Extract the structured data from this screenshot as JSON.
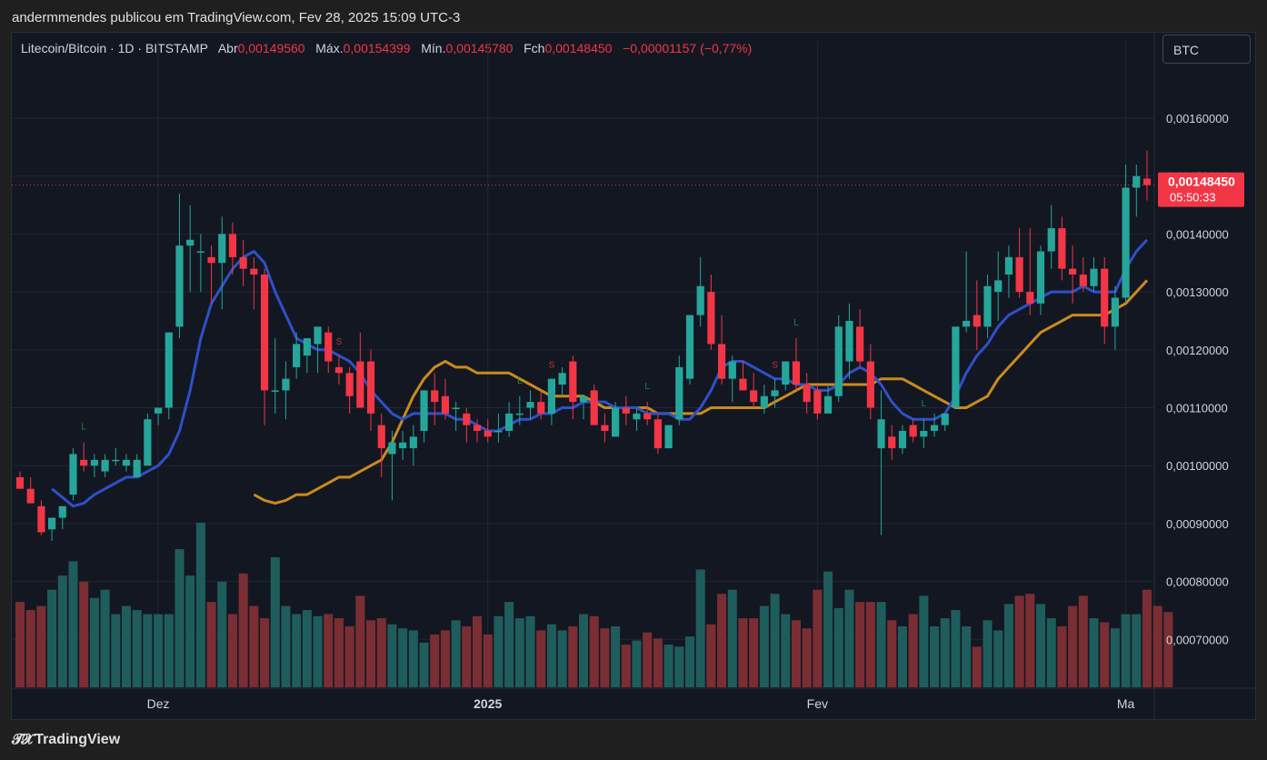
{
  "publisher_line": "andermmendes publicou em TradingView.com, Fev 28, 2025 15:09 UTC-3",
  "symbol": {
    "title": "Litecoin/Bitcoin · 1D · BITSTAMP",
    "open_label": "Abr",
    "open": "0,00149560",
    "high_label": "Máx.",
    "high": "0,00154399",
    "low_label": "Mín.",
    "low": "0,00145780",
    "close_label": "Fch",
    "close": "0,00148450",
    "change": "−0,00001157 (−0,77%)"
  },
  "currency_button": "BTC",
  "price_badge": {
    "price": "0,00148450",
    "countdown": "05:50:33"
  },
  "branding": {
    "icon": "tradingview-logo-icon",
    "name": "TradingView"
  },
  "colors": {
    "up": "#26a69a",
    "down": "#f23645",
    "fast_ma": "#2f50c8",
    "slow_ma": "#c98a1f",
    "vol_up": "#1f5c5c",
    "vol_down": "#7a2e33"
  },
  "chart_data": {
    "type": "candlestick",
    "title": "",
    "ylim": [
      0.00086,
      0.00169
    ],
    "y_ticks": [
      0.0016,
      0.0015,
      0.0014,
      0.0013,
      0.0012,
      0.0011,
      0.001,
      0.0009,
      0.0008,
      0.0007
    ],
    "y_tick_labels": [
      "0,00160000",
      "0,00150000",
      "0,00140000",
      "0,00130000",
      "0,00120000",
      "0,00110000",
      "0,00100000",
      "0,00090000",
      "0,00080000",
      "0,00070000"
    ],
    "x_labels": [
      {
        "text": "Dez",
        "index": 13
      },
      {
        "text": "2025",
        "index": 44
      },
      {
        "text": "Fev",
        "index": 75
      },
      {
        "text": "Ma",
        "index": 104
      }
    ],
    "candles": [
      [
        0.00098,
        0.00099,
        0.000965,
        0.00096
      ],
      [
        0.00096,
        0.00098,
        0.000935,
        0.000935
      ],
      [
        0.00093,
        0.00094,
        0.00088,
        0.000885
      ],
      [
        0.00089,
        0.0009,
        0.00087,
        0.00091
      ],
      [
        0.00091,
        0.00093,
        0.00089,
        0.00093
      ],
      [
        0.00095,
        0.00103,
        0.00094,
        0.00102
      ],
      [
        0.00101,
        0.00104,
        0.00099,
        0.001
      ],
      [
        0.001,
        0.00102,
        0.00098,
        0.00101
      ],
      [
        0.00099,
        0.00102,
        0.00098,
        0.00101
      ],
      [
        0.00101,
        0.00103,
        0.001,
        0.00101
      ],
      [
        0.001,
        0.00102,
        0.00099,
        0.00101
      ],
      [
        0.00098,
        0.00102,
        0.00098,
        0.00101
      ],
      [
        0.001,
        0.00109,
        0.001,
        0.00108
      ],
      [
        0.00109,
        0.0011,
        0.00107,
        0.0011
      ],
      [
        0.0011,
        0.00123,
        0.00108,
        0.00123
      ],
      [
        0.00124,
        0.00147,
        0.00122,
        0.00138
      ],
      [
        0.00138,
        0.00145,
        0.0013,
        0.00139
      ],
      [
        0.00137,
        0.0014,
        0.0013,
        0.00137
      ],
      [
        0.00136,
        0.00138,
        0.00128,
        0.00135
      ],
      [
        0.00135,
        0.00143,
        0.00127,
        0.0014
      ],
      [
        0.0014,
        0.00142,
        0.00133,
        0.00136
      ],
      [
        0.00136,
        0.00139,
        0.00131,
        0.00134
      ],
      [
        0.00134,
        0.00136,
        0.00127,
        0.00133
      ],
      [
        0.00133,
        0.00134,
        0.00107,
        0.00113
      ],
      [
        0.00113,
        0.00122,
        0.00109,
        0.00113
      ],
      [
        0.00113,
        0.00118,
        0.00108,
        0.00115
      ],
      [
        0.00117,
        0.00123,
        0.00115,
        0.00121
      ],
      [
        0.00119,
        0.00122,
        0.00116,
        0.00122
      ],
      [
        0.00121,
        0.00123,
        0.00116,
        0.00124
      ],
      [
        0.00123,
        0.00124,
        0.00116,
        0.00118
      ],
      [
        0.00117,
        0.00119,
        0.00114,
        0.00116
      ],
      [
        0.00116,
        0.00117,
        0.00109,
        0.00112
      ],
      [
        0.00118,
        0.00123,
        0.00112,
        0.0011
      ],
      [
        0.00118,
        0.0012,
        0.00106,
        0.00109
      ],
      [
        0.00107,
        0.00109,
        0.00098,
        0.00103
      ],
      [
        0.00102,
        0.00106,
        0.00094,
        0.00104
      ],
      [
        0.00103,
        0.00106,
        0.00101,
        0.00104
      ],
      [
        0.00103,
        0.00107,
        0.001,
        0.00105
      ],
      [
        0.00106,
        0.00113,
        0.00104,
        0.00113
      ],
      [
        0.00113,
        0.00116,
        0.00107,
        0.00111
      ],
      [
        0.00112,
        0.00115,
        0.00108,
        0.00109
      ],
      [
        0.0011,
        0.00111,
        0.00106,
        0.0011
      ],
      [
        0.00109,
        0.0011,
        0.00104,
        0.00107
      ],
      [
        0.00107,
        0.00108,
        0.00104,
        0.00106
      ],
      [
        0.00106,
        0.00108,
        0.00104,
        0.00105
      ],
      [
        0.00106,
        0.00109,
        0.00104,
        0.00106
      ],
      [
        0.00106,
        0.00111,
        0.00105,
        0.00109
      ],
      [
        0.00109,
        0.00112,
        0.00107,
        0.00109
      ],
      [
        0.0011,
        0.00113,
        0.00108,
        0.00111
      ],
      [
        0.00111,
        0.00113,
        0.00108,
        0.00109
      ],
      [
        0.00109,
        0.00115,
        0.00107,
        0.00115
      ],
      [
        0.00114,
        0.00117,
        0.00112,
        0.00116
      ],
      [
        0.00118,
        0.00119,
        0.00108,
        0.00111
      ],
      [
        0.00111,
        0.00112,
        0.00108,
        0.00112
      ],
      [
        0.00113,
        0.00114,
        0.00107,
        0.00107
      ],
      [
        0.00107,
        0.00109,
        0.00104,
        0.00106
      ],
      [
        0.00105,
        0.00111,
        0.00105,
        0.0011
      ],
      [
        0.0011,
        0.00112,
        0.00107,
        0.00109
      ],
      [
        0.00108,
        0.0011,
        0.00106,
        0.00109
      ],
      [
        0.00109,
        0.00111,
        0.00107,
        0.00108
      ],
      [
        0.00108,
        0.00109,
        0.00102,
        0.00103
      ],
      [
        0.00103,
        0.00107,
        0.00103,
        0.00107
      ],
      [
        0.00108,
        0.00119,
        0.00107,
        0.00117
      ],
      [
        0.00115,
        0.00126,
        0.00114,
        0.00126
      ],
      [
        0.00126,
        0.00136,
        0.00124,
        0.00131
      ],
      [
        0.0013,
        0.00133,
        0.0012,
        0.00121
      ],
      [
        0.00121,
        0.00126,
        0.00114,
        0.00115
      ],
      [
        0.00115,
        0.00119,
        0.00111,
        0.00118
      ],
      [
        0.00115,
        0.00118,
        0.00113,
        0.00113
      ],
      [
        0.00113,
        0.00116,
        0.0011,
        0.00111
      ],
      [
        0.0011,
        0.00114,
        0.00109,
        0.00112
      ],
      [
        0.00112,
        0.00115,
        0.0011,
        0.00113
      ],
      [
        0.00114,
        0.00118,
        0.00113,
        0.00118
      ],
      [
        0.00118,
        0.00122,
        0.00113,
        0.00114
      ],
      [
        0.00114,
        0.00116,
        0.00109,
        0.00111
      ],
      [
        0.00113,
        0.00114,
        0.00108,
        0.00109
      ],
      [
        0.00109,
        0.00114,
        0.00109,
        0.00112
      ],
      [
        0.00112,
        0.00126,
        0.00111,
        0.00124
      ],
      [
        0.00118,
        0.00128,
        0.00115,
        0.00125
      ],
      [
        0.00124,
        0.00127,
        0.00117,
        0.00118
      ],
      [
        0.00118,
        0.00121,
        0.00108,
        0.0011
      ],
      [
        0.00103,
        0.00113,
        0.00088,
        0.00108
      ],
      [
        0.00105,
        0.00107,
        0.00101,
        0.00103
      ],
      [
        0.00103,
        0.00107,
        0.00102,
        0.00106
      ],
      [
        0.00107,
        0.00108,
        0.00104,
        0.00105
      ],
      [
        0.00105,
        0.00108,
        0.00103,
        0.00106
      ],
      [
        0.00106,
        0.00109,
        0.00105,
        0.00107
      ],
      [
        0.00107,
        0.00109,
        0.00106,
        0.00109
      ],
      [
        0.0011,
        0.00124,
        0.0011,
        0.00124
      ],
      [
        0.00124,
        0.00137,
        0.00123,
        0.00125
      ],
      [
        0.00126,
        0.00132,
        0.0012,
        0.00124
      ],
      [
        0.00124,
        0.00133,
        0.00122,
        0.00131
      ],
      [
        0.0013,
        0.00137,
        0.00125,
        0.00132
      ],
      [
        0.00133,
        0.00138,
        0.00129,
        0.00136
      ],
      [
        0.00136,
        0.00141,
        0.00129,
        0.0013
      ],
      [
        0.0013,
        0.00141,
        0.00126,
        0.00128
      ],
      [
        0.00128,
        0.00138,
        0.00126,
        0.00137
      ],
      [
        0.00137,
        0.00145,
        0.00134,
        0.00141
      ],
      [
        0.00141,
        0.00143,
        0.00132,
        0.00134
      ],
      [
        0.00134,
        0.00138,
        0.00128,
        0.00133
      ],
      [
        0.00133,
        0.00136,
        0.0013,
        0.00131
      ],
      [
        0.00131,
        0.00136,
        0.0013,
        0.00134
      ],
      [
        0.00134,
        0.00136,
        0.00121,
        0.00124
      ],
      [
        0.00124,
        0.00131,
        0.0012,
        0.00129
      ],
      [
        0.00129,
        0.00152,
        0.00128,
        0.00148
      ],
      [
        0.00148,
        0.00152,
        0.00143,
        0.0015
      ],
      [
        0.0014956,
        0.00154399,
        0.0014578,
        0.0014845
      ]
    ],
    "volume": [
      42,
      38,
      40,
      48,
      55,
      62,
      52,
      44,
      48,
      36,
      40,
      38,
      36,
      36,
      36,
      68,
      55,
      81,
      42,
      52,
      36,
      56,
      40,
      34,
      64,
      40,
      36,
      38,
      35,
      36,
      34,
      30,
      45,
      33,
      34,
      31,
      29,
      28,
      22,
      26,
      28,
      33,
      30,
      35,
      26,
      35,
      42,
      34,
      35,
      28,
      31,
      28,
      30,
      36,
      35,
      29,
      30,
      21,
      23,
      27,
      24,
      21,
      20,
      25,
      58,
      31,
      46,
      48,
      34,
      34,
      40,
      46,
      36,
      33,
      29,
      48,
      57,
      39,
      48,
      42,
      42,
      42,
      33,
      30,
      36,
      45,
      30,
      34,
      38,
      30,
      20,
      33,
      28,
      41,
      45,
      46,
      41,
      34,
      30,
      40,
      45,
      34,
      32,
      29,
      36,
      36,
      48,
      40,
      37
    ],
    "fast_ma": [
      0.00096,
      0.000945,
      0.00093,
      0.000935,
      0.00095,
      0.00096,
      0.00097,
      0.00098,
      0.00098,
      0.00099,
      0.001,
      0.00102,
      0.00106,
      0.00113,
      0.00122,
      0.00128,
      0.00131,
      0.00134,
      0.00136,
      0.00137,
      0.00135,
      0.0013,
      0.00126,
      0.00122,
      0.00121,
      0.0012,
      0.0012,
      0.00119,
      0.00118,
      0.00116,
      0.00113,
      0.00111,
      0.00109,
      0.00108,
      0.00109,
      0.00109,
      0.00109,
      0.00109,
      0.00108,
      0.00108,
      0.00107,
      0.00106,
      0.00106,
      0.00107,
      0.00108,
      0.00108,
      0.00109,
      0.00109,
      0.0011,
      0.0011,
      0.00111,
      0.00111,
      0.00111,
      0.0011,
      0.0011,
      0.0011,
      0.00109,
      0.00109,
      0.00109,
      0.00108,
      0.00108,
      0.0011,
      0.00113,
      0.00117,
      0.00118,
      0.00118,
      0.00117,
      0.00116,
      0.00115,
      0.00115,
      0.00114,
      0.00114,
      0.00113,
      0.00113,
      0.00114,
      0.00116,
      0.00117,
      0.00116,
      0.00114,
      0.00111,
      0.00109,
      0.00108,
      0.00108,
      0.00108,
      0.00109,
      0.00112,
      0.00116,
      0.00119,
      0.00121,
      0.00124,
      0.00126,
      0.00127,
      0.00128,
      0.00129,
      0.0013,
      0.0013,
      0.0013,
      0.00131,
      0.0013,
      0.0013,
      0.0013,
      0.00134,
      0.00137,
      0.00139
    ],
    "slow_ma": [
      0.00095,
      0.00094,
      0.000935,
      0.00094,
      0.00095,
      0.00095,
      0.00096,
      0.00097,
      0.00098,
      0.00098,
      0.00099,
      0.001,
      0.00101,
      0.00104,
      0.00108,
      0.00112,
      0.00115,
      0.00117,
      0.00118,
      0.00117,
      0.00117,
      0.00116,
      0.00116,
      0.00116,
      0.00116,
      0.00115,
      0.00114,
      0.00113,
      0.00112,
      0.00112,
      0.00112,
      0.00112,
      0.00111,
      0.0011,
      0.0011,
      0.0011,
      0.0011,
      0.0011,
      0.00109,
      0.00109,
      0.00109,
      0.00109,
      0.00109,
      0.0011,
      0.0011,
      0.0011,
      0.0011,
      0.0011,
      0.0011,
      0.00111,
      0.00112,
      0.00113,
      0.00114,
      0.00114,
      0.00114,
      0.00114,
      0.00114,
      0.00114,
      0.00114,
      0.00115,
      0.00115,
      0.00115,
      0.00114,
      0.00113,
      0.00112,
      0.00111,
      0.0011,
      0.0011,
      0.00111,
      0.00112,
      0.00115,
      0.00117,
      0.00119,
      0.00121,
      0.00123,
      0.00124,
      0.00125,
      0.00126,
      0.00126,
      0.00126,
      0.00126,
      0.00127,
      0.00128,
      0.0013,
      0.00132
    ],
    "signals": [
      {
        "text": "L",
        "index": 6,
        "type": "long"
      },
      {
        "text": "S",
        "index": 30,
        "type": "short"
      },
      {
        "text": "L",
        "index": 47,
        "type": "long"
      },
      {
        "text": "S",
        "index": 50,
        "type": "short"
      },
      {
        "text": "L",
        "index": 59,
        "type": "long"
      },
      {
        "text": "S",
        "index": 71,
        "type": "short"
      },
      {
        "text": "L",
        "index": 73,
        "type": "long"
      },
      {
        "text": "L",
        "index": 85,
        "type": "long"
      }
    ]
  }
}
